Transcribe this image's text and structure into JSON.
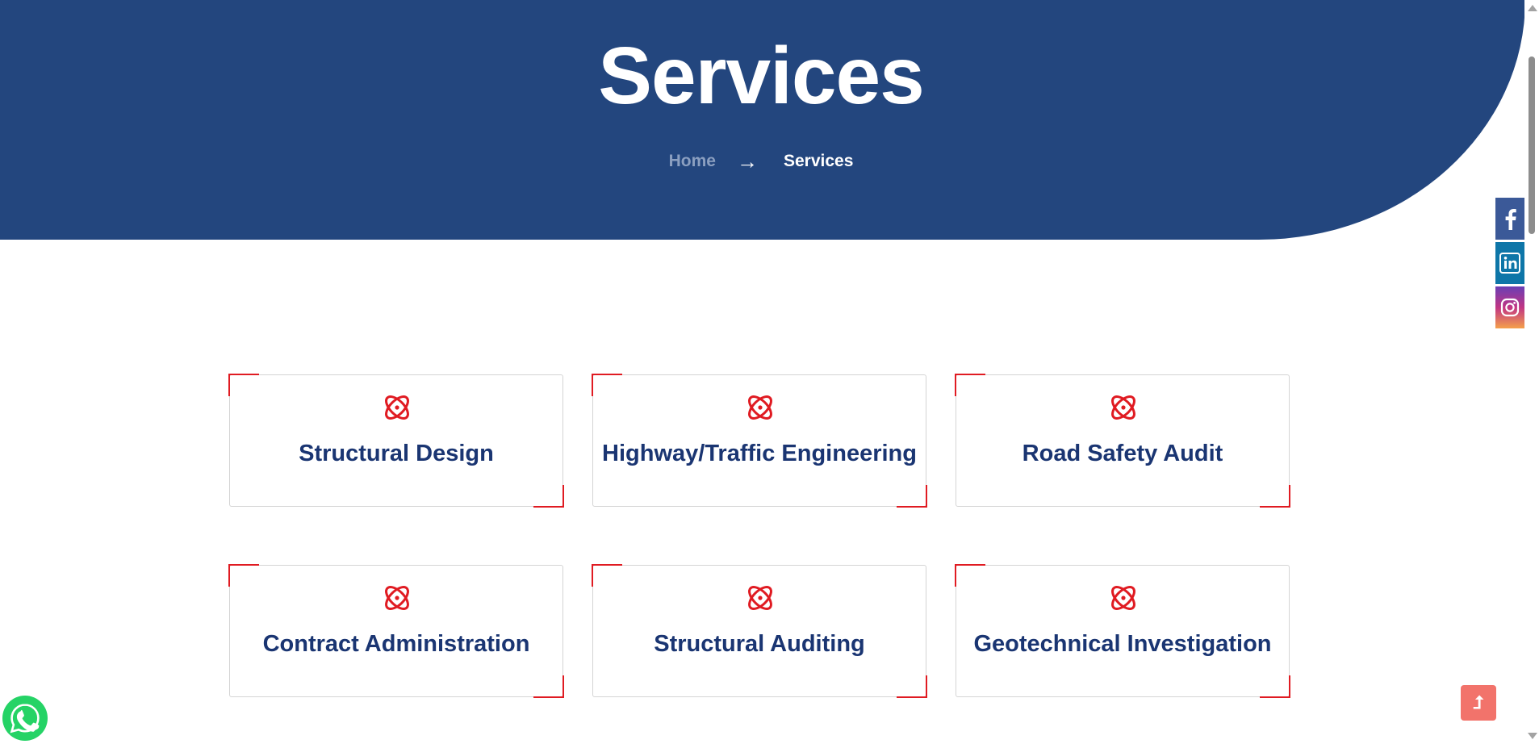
{
  "header": {
    "title": "Services",
    "breadcrumb": {
      "home": "Home",
      "separator": "→",
      "current": "Services"
    }
  },
  "social": [
    {
      "name": "facebook",
      "icon": "facebook-icon",
      "color": "#3b5998"
    },
    {
      "name": "linkedin",
      "icon": "linkedin-icon",
      "color": "#0e76a8"
    },
    {
      "name": "instagram",
      "icon": "instagram-icon",
      "color": "#c13584"
    }
  ],
  "services": [
    {
      "title": "Structural Design",
      "icon": "atom-icon"
    },
    {
      "title": "Highway/Traffic Engineering",
      "icon": "atom-icon"
    },
    {
      "title": "Road Safety Audit",
      "icon": "atom-icon"
    },
    {
      "title": "Contract Administration",
      "icon": "atom-icon"
    },
    {
      "title": "Structural Auditing",
      "icon": "atom-icon"
    },
    {
      "title": "Geotechnical Investigation",
      "icon": "atom-icon"
    }
  ],
  "floating": {
    "whatsapp_icon": "whatsapp-icon",
    "scroll_top_label": "⮥",
    "scroll_top_icon": "arrow-up-icon"
  },
  "colors": {
    "hero_bg": "#23467e",
    "card_title": "#1a3572",
    "accent_red": "#e01b22",
    "scroll_top_bg": "#f2736b",
    "whatsapp_green": "#25d366"
  }
}
